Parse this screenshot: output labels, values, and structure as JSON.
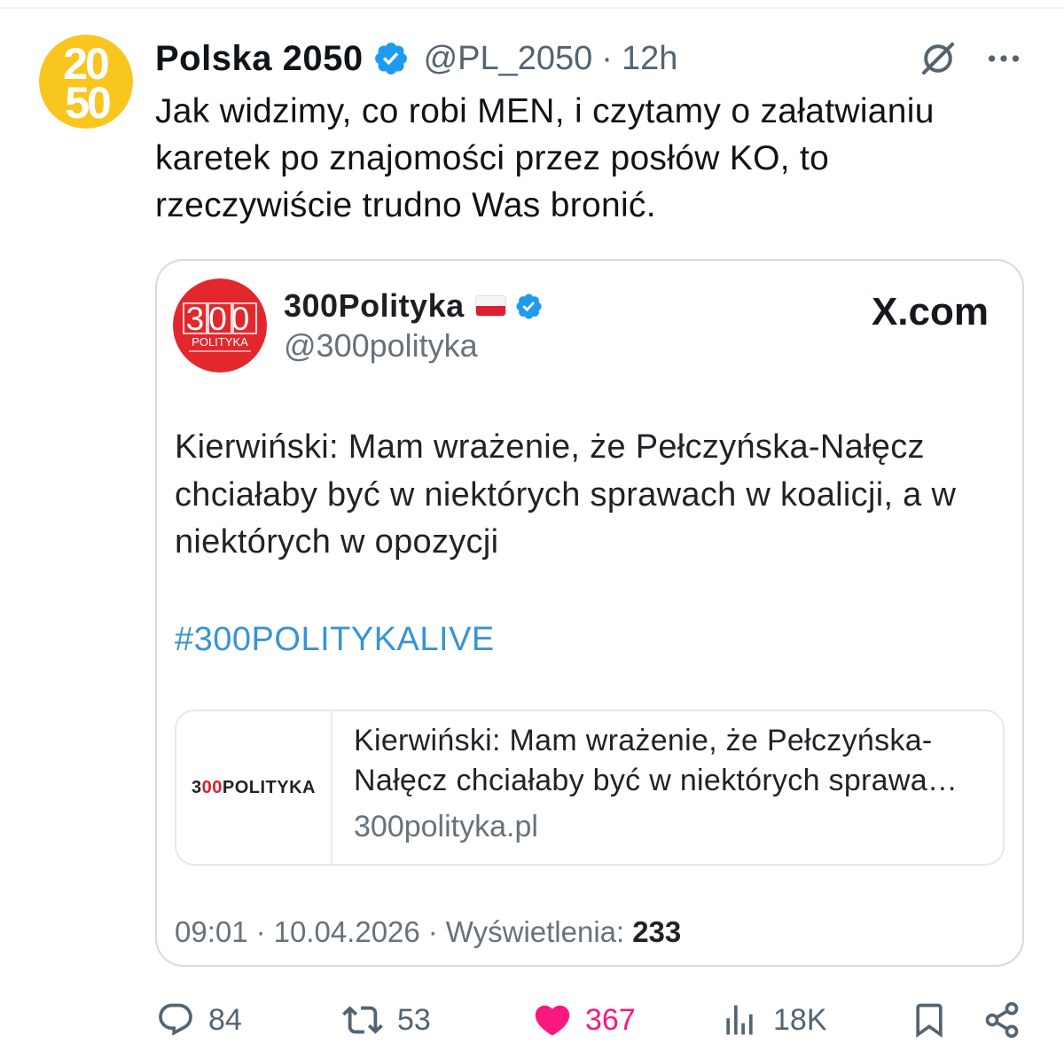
{
  "post": {
    "author": {
      "name": "Polska 2050",
      "handle": "@PL_2050",
      "separator": "·",
      "time": "12h",
      "verified": true,
      "avatar": {
        "logo_top": "20",
        "logo_bottom": "50"
      }
    },
    "header_icons": {
      "grok": "grok-icon",
      "more": "more-icon"
    },
    "text_lines": [
      "Jak widzimy, co robi MEN, i czytamy o załatwianiu",
      "karetek po znajomości przez posłów KO, to",
      "rzeczywiście trudno Was bronić."
    ]
  },
  "attached_image": {
    "author": {
      "name": "300Polityka",
      "flag_icon": "poland-flag-icon",
      "verified": true,
      "handle": "@300polityka",
      "avatar": {
        "logo_main": "300",
        "logo_sub": "POLITYKA"
      }
    },
    "source_label": "X.com",
    "text_lines": [
      "Kierwiński: Mam wrażenie, że Pełczyńska-Nałęcz",
      "chciałaby być w niektórych sprawach w koalicji, a w",
      "niektórych w opozycji"
    ],
    "hashtag": "#300POLITYKALIVE",
    "link_card": {
      "thumbnail_logo": {
        "part1": "3",
        "part2": "00",
        "part3": "POLITYKA"
      },
      "title_lines": [
        "Kierwiński: Mam wrażenie, że Pełczyńska-",
        "Nałęcz chciałaby być w niektórych sprawa…"
      ],
      "domain": "300polityka.pl"
    },
    "footer": {
      "time": "09:01",
      "separator": "·",
      "date": "10.04.2026",
      "views_label": "Wyświetlenia:",
      "views_count": "233"
    }
  },
  "actions": {
    "reply": {
      "icon": "reply-icon",
      "count": "84"
    },
    "repost": {
      "icon": "repost-icon",
      "count": "53"
    },
    "like": {
      "icon": "heart-icon",
      "count": "367",
      "active": true
    },
    "views": {
      "icon": "views-icon",
      "count": "18K"
    },
    "bookmark": {
      "icon": "bookmark-icon"
    },
    "share": {
      "icon": "share-icon"
    }
  },
  "colors": {
    "primary_text": "#0f1419",
    "secondary_text": "#536471",
    "verified_badge": "#1d9bf0",
    "like_active": "#f91880",
    "hashtag": "#3794d6",
    "polska2050_yellow": "#f9c51f",
    "polityka_red": "#e4262d",
    "card_border": "#d4dbe0"
  }
}
